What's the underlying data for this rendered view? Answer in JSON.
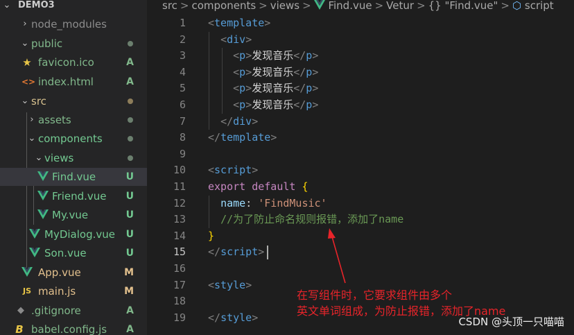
{
  "explorer": {
    "root_label": "DEMO3",
    "items": [
      {
        "label": "node_modules",
        "status": "",
        "dot": false
      },
      {
        "label": "public",
        "status": "",
        "dot": true
      },
      {
        "label": "favicon.ico",
        "status": "A",
        "dot": false
      },
      {
        "label": "index.html",
        "status": "A",
        "dot": false
      },
      {
        "label": "src",
        "status": "",
        "dot": true
      },
      {
        "label": "assets",
        "status": "",
        "dot": true
      },
      {
        "label": "components",
        "status": "",
        "dot": true
      },
      {
        "label": "views",
        "status": "",
        "dot": true
      },
      {
        "label": "Find.vue",
        "status": "U",
        "dot": false
      },
      {
        "label": "Friend.vue",
        "status": "U",
        "dot": false
      },
      {
        "label": "My.vue",
        "status": "U",
        "dot": false
      },
      {
        "label": "MyDialog.vue",
        "status": "U",
        "dot": false
      },
      {
        "label": "Son.vue",
        "status": "U",
        "dot": false
      },
      {
        "label": "App.vue",
        "status": "M",
        "dot": false
      },
      {
        "label": "main.js",
        "status": "M",
        "dot": false
      },
      {
        "label": ".gitignore",
        "status": "A",
        "dot": false
      },
      {
        "label": "babel.config.js",
        "status": "A",
        "dot": false
      }
    ],
    "selected": "Find.vue",
    "colors": {
      "untracked": "#73c991",
      "modified": "#e2c08d",
      "added": "#81b88b",
      "ignored": "#8c8c8c"
    },
    "icons": {
      "js_glyph": "JS",
      "html_glyph": "<>"
    }
  },
  "breadcrumb": {
    "items": [
      "src",
      "components",
      "views",
      "Find.vue",
      "Vetur",
      "{} \"Find.vue\"",
      "script"
    ],
    "separator": ">"
  },
  "editor": {
    "active_line": 15,
    "line_numbers": [
      "1",
      "2",
      "3",
      "4",
      "5",
      "6",
      "7",
      "8",
      "9",
      "10",
      "11",
      "12",
      "13",
      "14",
      "15",
      "16",
      "17",
      "18",
      "19"
    ],
    "lines": [
      [
        {
          "t": "<",
          "c": "punct"
        },
        {
          "t": "template",
          "c": "tag"
        },
        {
          "t": ">",
          "c": "punct"
        }
      ],
      [
        {
          "t": "  "
        },
        {
          "t": "<",
          "c": "punct"
        },
        {
          "t": "div",
          "c": "tag"
        },
        {
          "t": ">",
          "c": "punct"
        }
      ],
      [
        {
          "t": "    "
        },
        {
          "t": "<",
          "c": "punct"
        },
        {
          "t": "p",
          "c": "tag"
        },
        {
          "t": ">",
          "c": "punct"
        },
        {
          "t": "发现音乐",
          "c": "text"
        },
        {
          "t": "</",
          "c": "punct"
        },
        {
          "t": "p",
          "c": "tag"
        },
        {
          "t": ">",
          "c": "punct"
        }
      ],
      [
        {
          "t": "    "
        },
        {
          "t": "<",
          "c": "punct"
        },
        {
          "t": "p",
          "c": "tag"
        },
        {
          "t": ">",
          "c": "punct"
        },
        {
          "t": "发现音乐",
          "c": "text"
        },
        {
          "t": "</",
          "c": "punct"
        },
        {
          "t": "p",
          "c": "tag"
        },
        {
          "t": ">",
          "c": "punct"
        }
      ],
      [
        {
          "t": "    "
        },
        {
          "t": "<",
          "c": "punct"
        },
        {
          "t": "p",
          "c": "tag"
        },
        {
          "t": ">",
          "c": "punct"
        },
        {
          "t": "发现音乐",
          "c": "text"
        },
        {
          "t": "</",
          "c": "punct"
        },
        {
          "t": "p",
          "c": "tag"
        },
        {
          "t": ">",
          "c": "punct"
        }
      ],
      [
        {
          "t": "    "
        },
        {
          "t": "<",
          "c": "punct"
        },
        {
          "t": "p",
          "c": "tag"
        },
        {
          "t": ">",
          "c": "punct"
        },
        {
          "t": "发现音乐",
          "c": "text"
        },
        {
          "t": "</",
          "c": "punct"
        },
        {
          "t": "p",
          "c": "tag"
        },
        {
          "t": ">",
          "c": "punct"
        }
      ],
      [
        {
          "t": "  "
        },
        {
          "t": "</",
          "c": "punct"
        },
        {
          "t": "div",
          "c": "tag"
        },
        {
          "t": ">",
          "c": "punct"
        }
      ],
      [
        {
          "t": "</",
          "c": "punct"
        },
        {
          "t": "template",
          "c": "tag"
        },
        {
          "t": ">",
          "c": "punct"
        }
      ],
      [],
      [
        {
          "t": "<",
          "c": "punct"
        },
        {
          "t": "script",
          "c": "tag"
        },
        {
          "t": ">",
          "c": "punct"
        }
      ],
      [
        {
          "t": "export",
          "c": "kw"
        },
        {
          "t": " "
        },
        {
          "t": "default",
          "c": "kw"
        },
        {
          "t": " "
        },
        {
          "t": "{",
          "c": "brace"
        }
      ],
      [
        {
          "t": "  "
        },
        {
          "t": "name",
          "c": "prop"
        },
        {
          "t": ": ",
          "c": "text"
        },
        {
          "t": "'FindMusic'",
          "c": "str"
        }
      ],
      [
        {
          "t": "  "
        },
        {
          "t": "//为了防止命名规则报错，添加了name",
          "c": "cmt"
        }
      ],
      [
        {
          "t": "}",
          "c": "brace"
        }
      ],
      [
        {
          "t": "</",
          "c": "punct"
        },
        {
          "t": "script",
          "c": "tag"
        },
        {
          "t": ">",
          "c": "punct"
        }
      ],
      [],
      [
        {
          "t": "<",
          "c": "punct"
        },
        {
          "t": "style",
          "c": "tag"
        },
        {
          "t": ">",
          "c": "punct"
        }
      ],
      [],
      [
        {
          "t": "</",
          "c": "punct"
        },
        {
          "t": "style",
          "c": "tag"
        },
        {
          "t": ">",
          "c": "punct"
        }
      ]
    ],
    "token_colors": {
      "punct": "#808080",
      "tag": "#569cd6",
      "text": "#d4d4d4",
      "kw": "#c586c0",
      "brace": "#ffd700",
      "prop": "#9cdcfe",
      "str": "#ce9178",
      "cmt": "#6a9955"
    }
  },
  "annotation": {
    "line1": "在写组件时，它要求组件由多个",
    "line2": "英文单词组成，为防止报错，添加了name",
    "color": "#e8242a"
  },
  "watermark": "CSDN @头顶一只喵喵"
}
